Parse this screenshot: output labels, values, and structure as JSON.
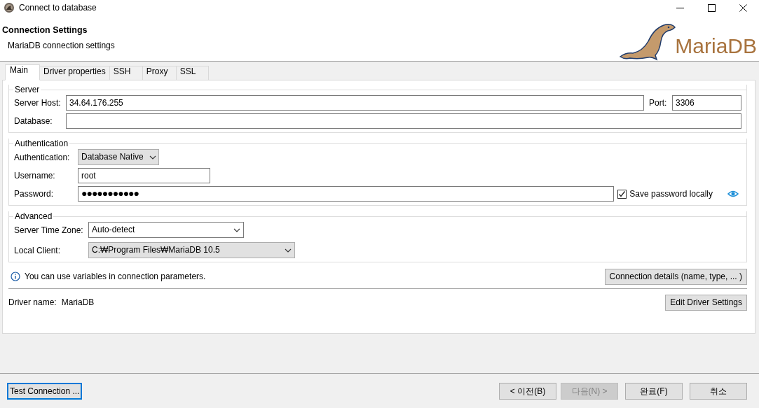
{
  "window": {
    "title": "Connect to database"
  },
  "header": {
    "title": "Connection Settings",
    "subtitle": "MariaDB connection settings",
    "logo_text": "MariaDB"
  },
  "tabs": [
    {
      "label": "Main",
      "selected": true
    },
    {
      "label": "Driver properties",
      "selected": false
    },
    {
      "label": "SSH",
      "selected": false
    },
    {
      "label": "Proxy",
      "selected": false
    },
    {
      "label": "SSL",
      "selected": false
    }
  ],
  "server": {
    "title": "Server",
    "host": {
      "label": "Server Host:",
      "value": "34.64.176.255"
    },
    "port": {
      "label": "Port:",
      "value": "3306"
    },
    "database": {
      "label": "Database:"
    }
  },
  "authentication": {
    "title": "Authentication",
    "method": {
      "label": "Authentication:",
      "value": "Database Native",
      "editable": false
    },
    "username": {
      "label": "Username:",
      "value": "root"
    },
    "password": {
      "label": "Password:",
      "value": "●●●●●●●●●●●"
    },
    "save_password": {
      "label": "Save password locally",
      "checked": true
    }
  },
  "advanced": {
    "title": "Advanced",
    "time_zone": {
      "label": "Server Time Zone:",
      "value": "Auto-detect",
      "editable": true
    },
    "local_client": {
      "label": "Local Client:",
      "value": "C:₩Program Files₩MariaDB 10.5",
      "editable": false
    }
  },
  "info": {
    "text": "You can use variables in connection parameters.",
    "button": "Connection details (name, type, ... )"
  },
  "driver": {
    "label": "Driver name:",
    "value": "MariaDB",
    "button": "Edit Driver Settings"
  },
  "footer": {
    "test_button": "Test Connection ...",
    "buttons": [
      {
        "label": "< 이전(B)",
        "disabled": false
      },
      {
        "label": "다음(N) >",
        "disabled": true
      },
      {
        "label": "완료(F)",
        "disabled": false
      },
      {
        "label": "취소",
        "disabled": false
      }
    ]
  }
}
